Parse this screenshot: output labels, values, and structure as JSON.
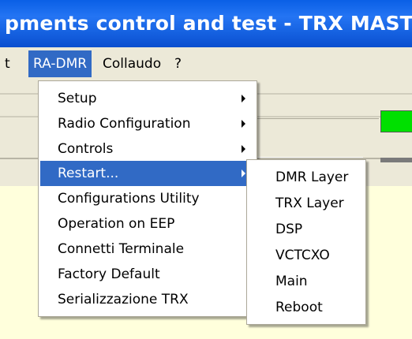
{
  "window": {
    "title": "pments control and test - TRX MASTER VH"
  },
  "menubar": {
    "items": [
      {
        "label": "t"
      },
      {
        "label": "RA-DMR"
      },
      {
        "label": "Collaudo"
      },
      {
        "label": "?"
      }
    ]
  },
  "ra_dmr_menu": {
    "items": [
      {
        "label": "Setup",
        "submenu": true
      },
      {
        "label": "Radio Configuration",
        "submenu": true
      },
      {
        "label": "Controls",
        "submenu": true
      },
      {
        "label": "Restart...",
        "submenu": true,
        "highlighted": true
      },
      {
        "label": "Configurations Utility"
      },
      {
        "label": "Operation on EEP"
      },
      {
        "label": "Connetti Terminale"
      },
      {
        "label": "Factory Default"
      },
      {
        "label": "Serializzazione TRX"
      }
    ]
  },
  "restart_submenu": {
    "items": [
      {
        "label": "DMR Layer"
      },
      {
        "label": "TRX Layer"
      },
      {
        "label": "DSP"
      },
      {
        "label": "VCTCXO"
      },
      {
        "label": "Main"
      },
      {
        "label": "Reboot"
      }
    ]
  },
  "colors": {
    "titlebar": "#0a5fe6",
    "menu_highlight": "#316ac5",
    "menubar_bg": "#ece9d8",
    "window_bg": "#ffffdc",
    "status_led": "#00e000"
  }
}
